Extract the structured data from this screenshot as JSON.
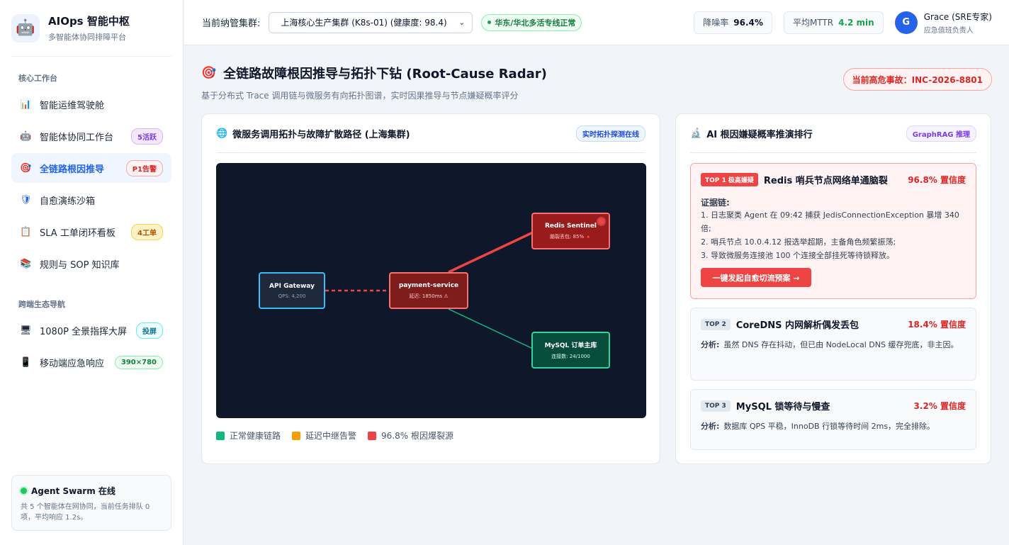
{
  "brand": {
    "logo_icon": "🤖",
    "title": "AIOps 智能中枢",
    "subtitle": "多智能体协同排障平台"
  },
  "nav": {
    "section_core": "核心工作台",
    "section_cross": "跨端生态导航",
    "items": [
      {
        "icon": "📊",
        "label": "智能运维驾驶舱",
        "badge": ""
      },
      {
        "icon": "🤖",
        "label": "智能体协同工作台",
        "badge": "5活跃"
      },
      {
        "icon": "🎯",
        "label": "全链路根因推导",
        "badge": "P1告警"
      },
      {
        "icon": "🛡",
        "label": "自愈演练沙箱",
        "badge": ""
      },
      {
        "icon": "📋",
        "label": "SLA 工单闭环看板",
        "badge": "4工单"
      },
      {
        "icon": "📚",
        "label": "规则与 SOP 知识库",
        "badge": ""
      },
      {
        "icon": "🖥",
        "label": "1080P 全景指挥大屏",
        "badge": "投屏"
      },
      {
        "icon": "📱",
        "label": "移动端应急响应",
        "badge": "390×780"
      }
    ]
  },
  "swarm": {
    "title": "Agent Swarm 在线",
    "desc": "共 5 个智能体在网协同，当前任务排队 0 项，平均响应 1.2s。"
  },
  "topbar": {
    "cluster_label": "当前纳管集群:",
    "cluster_value": "上海核心生产集群 (K8s-01) (健康度: 98.4)",
    "status": "华东/华北多活专线正常",
    "kpi_noise_label": "降噪率",
    "kpi_noise_value": "96.4%",
    "kpi_mttr_label": "平均MTTR",
    "kpi_mttr_value": "4.2 min",
    "user_initial": "G",
    "user_name": "Grace (SRE专家)",
    "user_role": "应急值班负责人"
  },
  "page": {
    "icon": "🎯",
    "title": "全链路故障根因推导与拓扑下钻 (Root-Cause Radar)",
    "subtitle": "基于分布式 Trace 调用链与微服务有向拓扑图谱，实时因果推导与节点嫌疑概率评分",
    "incident": "当前高危事故：INC-2026-8801"
  },
  "topology": {
    "icon": "🌐",
    "title": "微服务调用拓扑与故障扩散路径 (上海集群)",
    "tag": "实时拓扑探测在线",
    "nodes": {
      "gateway": {
        "name": "API Gateway",
        "metric": "QPS: 4,200"
      },
      "payment": {
        "name": "payment-service",
        "metric": "延迟: 1850ms ⚠"
      },
      "redis": {
        "name": "Redis Sentinel",
        "metric": "脑裂丢包: 85% 🔺"
      },
      "mysql": {
        "name": "MySQL 订单主库",
        "metric": "连接数: 24/1000"
      }
    },
    "legend": [
      {
        "label": "正常健康链路",
        "color": "#10b981"
      },
      {
        "label": "延迟中继告警",
        "color": "#f59e0b"
      },
      {
        "label": "96.8% 根因爆裂源",
        "color": "#ef4444"
      }
    ]
  },
  "rootcause": {
    "icon": "🔬",
    "title": "AI 根因嫌疑概率推演排行",
    "tag": "GraphRAG 推理",
    "top1": {
      "rank": "TOP 1 极高嫌疑",
      "title": "Redis 哨兵节点网络单通脑裂",
      "confidence": "96.8% 置信度",
      "evidence_label": "证据链:",
      "evidence": [
        "1. 日志聚类 Agent 在 09:42 捕获 JedisConnectionException 暴增 340 倍;",
        "2. 哨兵节点 10.0.4.12 报选举超期，主备角色频繁振荡;",
        "3. 导致微服务连接池 100 个连接全部挂死等待锁释放。"
      ],
      "action": "一键发起自愈切流预案 →"
    },
    "top2": {
      "rank": "TOP 2",
      "title": "CoreDNS 内网解析偶发丢包",
      "confidence": "18.4% 置信度",
      "analysis_label": "分析:",
      "analysis": "虽然 DNS 存在抖动，但已由 NodeLocal DNS 缓存兜底，非主因。"
    },
    "top3": {
      "rank": "TOP 3",
      "title": "MySQL 锁等待与慢查",
      "confidence": "3.2% 置信度",
      "analysis_label": "分析:",
      "analysis": "数据库 QPS 平稳，InnoDB 行锁等待时间 2ms，完全排除。"
    }
  }
}
